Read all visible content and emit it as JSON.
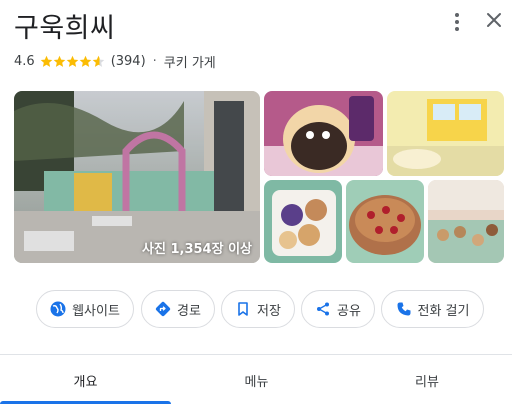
{
  "place": {
    "name": "구욱희씨",
    "rating": "4.6",
    "rating_value": 4.6,
    "stars_max": 5,
    "review_count": "(394)",
    "separator": "·",
    "category": "쿠키 가게"
  },
  "icons": {
    "more": "more-vert-icon",
    "close": "close-icon",
    "star": "star-icon",
    "website": "globe-icon",
    "directions": "directions-icon",
    "save": "bookmark-icon",
    "share": "share-icon",
    "call": "phone-icon"
  },
  "photos": {
    "count_label": "사진 1,354장 이상"
  },
  "actions": {
    "website": "웹사이트",
    "directions": "경로",
    "save": "저장",
    "share": "공유",
    "call": "전화 걸기"
  },
  "tabs": [
    {
      "label": "개요",
      "active": true
    },
    {
      "label": "메뉴",
      "active": false
    },
    {
      "label": "리뷰",
      "active": false
    }
  ],
  "colors": {
    "star": "#fbbc04",
    "accent": "#1a73e8",
    "text": "#202124",
    "muted": "#5f6368"
  }
}
